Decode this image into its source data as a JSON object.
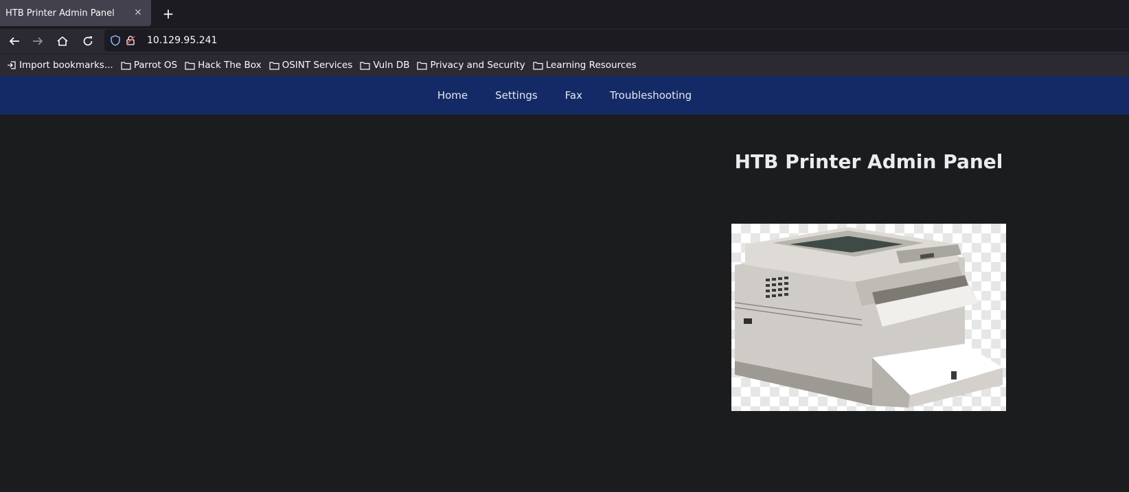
{
  "browser": {
    "tab_title": "HTB Printer Admin Panel",
    "close_symbol": "×",
    "newtab_symbol": "+",
    "url": "10.129.95.241"
  },
  "bookmarks": [
    {
      "label": "Import bookmarks...",
      "icon": "import-icon"
    },
    {
      "label": "Parrot OS",
      "icon": "folder-icon"
    },
    {
      "label": "Hack The Box",
      "icon": "folder-icon"
    },
    {
      "label": "OSINT Services",
      "icon": "folder-icon"
    },
    {
      "label": "Vuln DB",
      "icon": "folder-icon"
    },
    {
      "label": "Privacy and Security",
      "icon": "folder-icon"
    },
    {
      "label": "Learning Resources",
      "icon": "folder-icon"
    }
  ],
  "site": {
    "nav": [
      "Home",
      "Settings",
      "Fax",
      "Troubleshooting"
    ],
    "title": "HTB Printer Admin Panel",
    "nav_color": "#142a66"
  }
}
